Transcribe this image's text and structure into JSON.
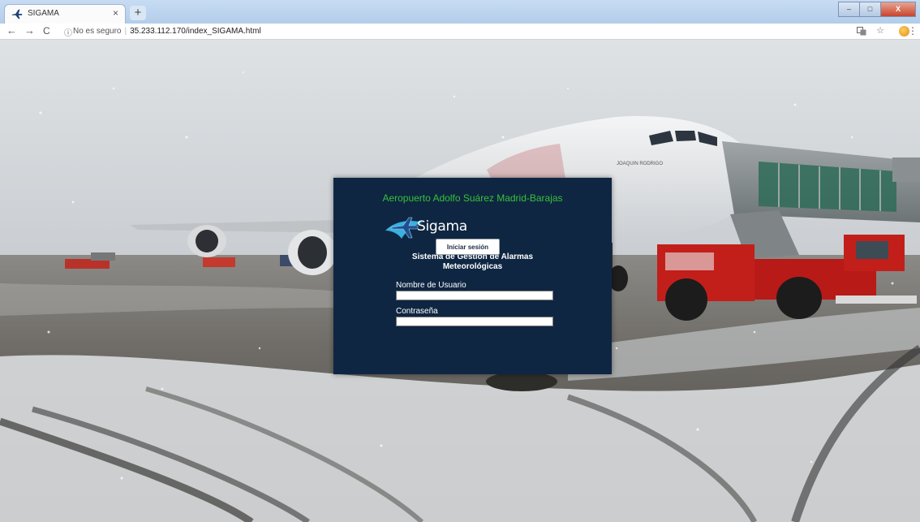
{
  "browser": {
    "tab_title": "SIGAMA",
    "tab_close": "×",
    "new_tab": "+",
    "back": "←",
    "forward": "→",
    "reload": "C",
    "info": "ⓘ",
    "security_text": "No es seguro",
    "separator": "|",
    "url": "35.233.112.170/index_SIGAMA.html",
    "star": "☆",
    "menu": "⋮",
    "win_minimize": "–",
    "win_maximize": "□",
    "win_close": "X"
  },
  "login": {
    "airport_title": "Aeropuerto Adolfo Suárez Madrid-Barajas",
    "logo_text": "Sigama",
    "subtitle_line1": "Sistema de Gestión de Alarmas",
    "subtitle_line2": "Meteorológicas",
    "username_label": "Nombre de Usuario",
    "password_label": "Contraseña",
    "username_value": "",
    "password_value": "",
    "submit_label": "Iniciar sesión"
  },
  "scene": {
    "aircraft_label": "JOAQUIN RODRIGO"
  },
  "colors": {
    "panel_bg": "#0f2642",
    "airport_title": "#35c13a",
    "logo_accent": "#3ab0e0"
  }
}
